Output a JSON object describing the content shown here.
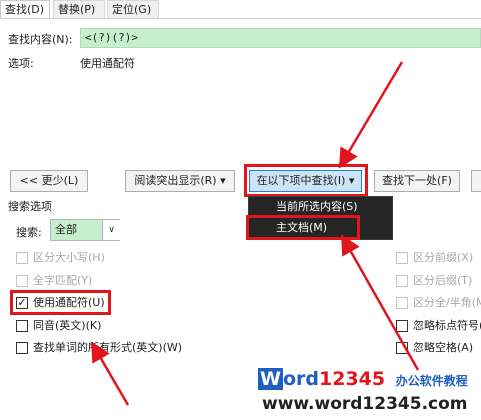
{
  "tabs": [
    "查找(D)",
    "替换(P)",
    "定位(G)"
  ],
  "find": {
    "label": "查找内容(N):",
    "value": "<(?)(?)>"
  },
  "options": {
    "label": "选项:",
    "value": "使用通配符"
  },
  "buttons": {
    "less": "<< 更少(L)",
    "highlight": "阅读突出显示(R) ▾",
    "find_in": "在以下项中查找(I) ▾",
    "find_next": "查找下一处(F)"
  },
  "menu": [
    "当前所选内容(S)",
    "主文档(M)"
  ],
  "search_options": {
    "title": "搜索选项",
    "search_label": "搜索:",
    "search_value": "全部",
    "left_checks": [
      {
        "label": "区分大小写(H)",
        "checked": false,
        "disabled": true
      },
      {
        "label": "全字匹配(Y)",
        "checked": false,
        "disabled": true
      },
      {
        "label": "使用通配符(U)",
        "checked": true,
        "disabled": false
      },
      {
        "label": "同音(英文)(K)",
        "checked": false,
        "disabled": false
      },
      {
        "label": "查找单词的所有形式(英文)(W)",
        "checked": false,
        "disabled": false
      }
    ],
    "right_checks": [
      {
        "label": "区分前缀(X)",
        "checked": false,
        "disabled": true
      },
      {
        "label": "区分后缀(T)",
        "checked": false,
        "disabled": true
      },
      {
        "label": "区分全/半角(M)",
        "checked": false,
        "disabled": true
      },
      {
        "label": "忽略标点符号(",
        "checked": false,
        "disabled": false
      },
      {
        "label": "忽略空格(A)",
        "checked": false,
        "disabled": false
      }
    ]
  },
  "watermark": {
    "brand_W": "W",
    "brand_ord": "ord",
    "brand_num": "12345",
    "brand_cn": "办公软件教程",
    "url": "www.word12345.com"
  },
  "colors": {
    "accent_red": "#e0161c",
    "find_field_bg": "#c6efce",
    "menu_bg": "#252526",
    "active_button": "#cce4f7"
  }
}
